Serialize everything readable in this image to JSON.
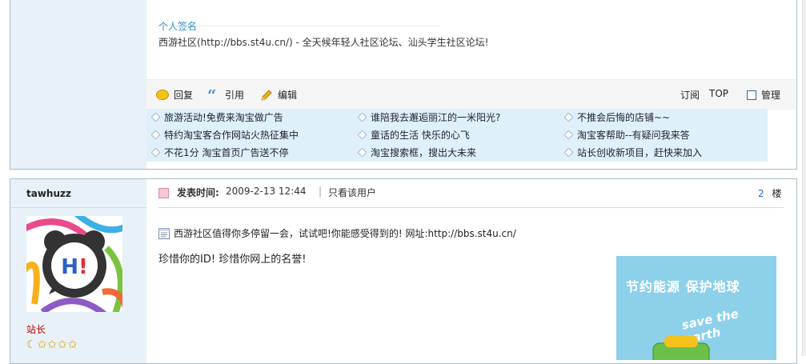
{
  "post1": {
    "signature_label": "个人签名",
    "signature_text": "西游社区(http://bbs.st4u.cn/) - 全天候年轻人社区论坛、汕头学生社区论坛!",
    "actions": {
      "reply": "回复",
      "quote": "引用",
      "edit": "编辑",
      "subscribe": "订阅",
      "top": "TOP",
      "manage": "管理"
    },
    "ads": [
      [
        "旅游活动!免费来淘宝做广告",
        "谁陪我去邂逅丽江的一米阳光?",
        "不推会后悔的店铺~~"
      ],
      [
        "特约淘宝客合作网站火热征集中",
        "童话的生活 快乐的心飞",
        "淘宝客帮助--有疑问我来答"
      ],
      [
        "不花1分 淘宝首页广告送不停",
        "淘宝搜索框，搜出大未来",
        "站长创收新项目，赶快来加入"
      ]
    ]
  },
  "post2": {
    "username": "tawhuzz",
    "rank": "站长",
    "posted_label": "发表时间:",
    "posted_time": "2009-2-13 12:44",
    "separator": "|",
    "only_user": "只看该用户",
    "floor_num": "2",
    "floor_unit": "楼",
    "notice": "西游社区值得你多停留一会，试试吧!你能感受得到的!  网址:http://bbs.st4u.cn/",
    "body": "珍惜你的ID! 珍惜你网上的名誉!",
    "avatar_text": "H!",
    "banner_title": "节约能源 保护地球",
    "banner_sub": "save the earth"
  },
  "colors": {
    "accent_blue": "#2a8dc7",
    "rank_red": "#c00000",
    "sidebar": "#e8f1f8",
    "ad_bg": "#def0f9"
  }
}
